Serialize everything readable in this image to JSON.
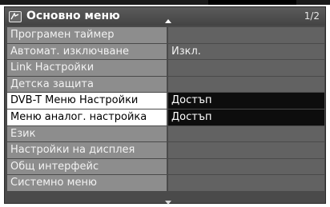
{
  "header": {
    "title": "Основно меню",
    "page": "1/2"
  },
  "colors": {
    "menu_bg": "#4a4a4a",
    "item_bg": "#8d8d8d",
    "value_bg": "#626262",
    "highlight_label_bg": "#ffffff",
    "highlight_value_bg": "#0d0d0d"
  },
  "icons": {
    "menu": "settings-menu-icon",
    "scroll_up": "chevron-up-icon",
    "scroll_down": "chevron-down-icon"
  },
  "items": [
    {
      "label": "Програмен таймер",
      "value": ""
    },
    {
      "label": "Автомат. изключване",
      "value": "Изкл."
    },
    {
      "label": "Link Настройки",
      "value": ""
    },
    {
      "label": "Детска защита",
      "value": ""
    },
    {
      "label": "DVB-T Меню Настройки",
      "value": "Достъп"
    },
    {
      "label": "Меню аналог. настройка",
      "value": "Достъп"
    },
    {
      "label": "Език",
      "value": ""
    },
    {
      "label": "Настройки на дисплея",
      "value": ""
    },
    {
      "label": "Общ интерфейс",
      "value": ""
    },
    {
      "label": "Системно меню",
      "value": ""
    }
  ]
}
